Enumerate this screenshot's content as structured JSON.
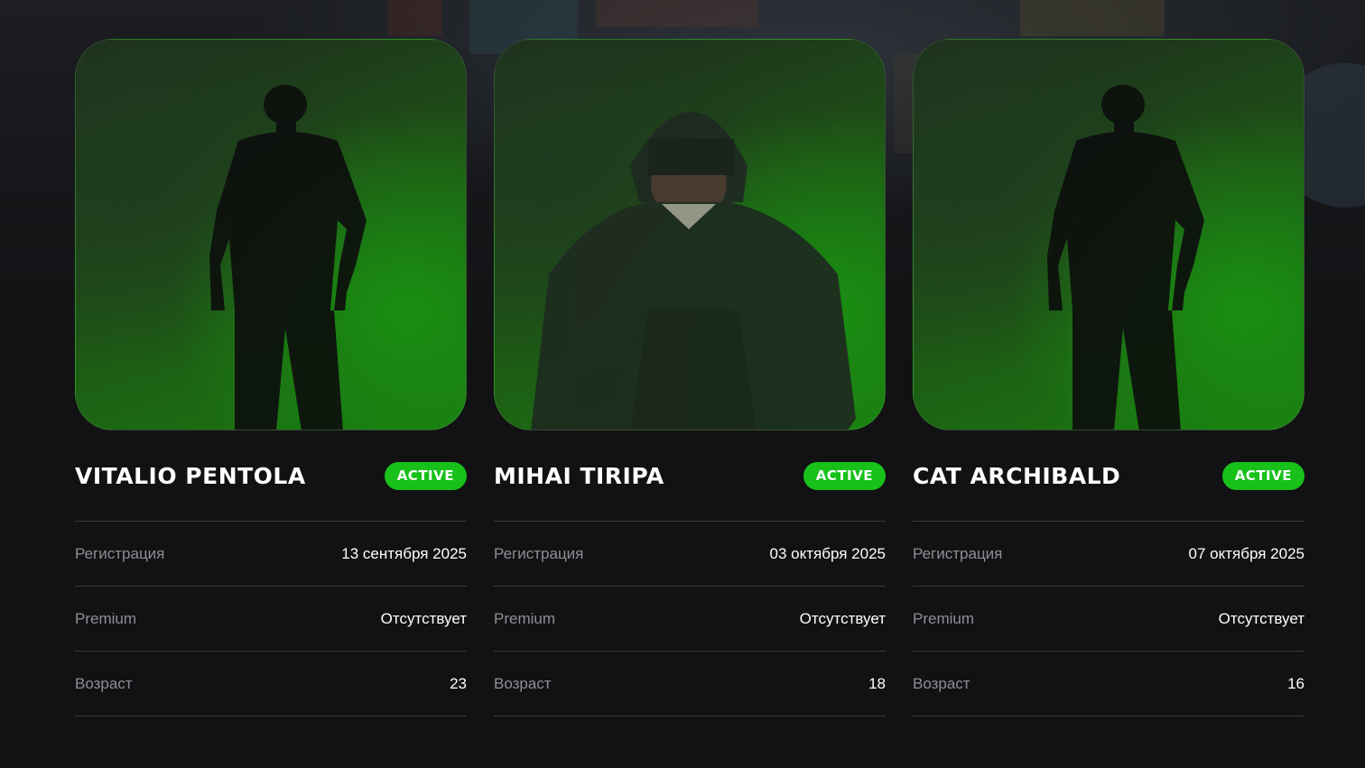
{
  "colors": {
    "background": "#121214",
    "badge": "#17c11a",
    "portrait_green": "#1a8f12",
    "divider": "#3a3b3f",
    "label": "#8e8f94"
  },
  "characters": [
    {
      "name": "VITALIO PENTOLA",
      "status": "ACTIVE",
      "portrait": "silhouette",
      "rows": [
        {
          "label": "Регистрация",
          "value": "13 сентября 2025"
        },
        {
          "label": "Premium",
          "value": "Отсутствует"
        },
        {
          "label": "Возраст",
          "value": "23"
        }
      ]
    },
    {
      "name": "MIHAI TIRIPA",
      "status": "ACTIVE",
      "portrait": "hooded-figure",
      "rows": [
        {
          "label": "Регистрация",
          "value": "03 октября 2025"
        },
        {
          "label": "Premium",
          "value": "Отсутствует"
        },
        {
          "label": "Возраст",
          "value": "18"
        }
      ]
    },
    {
      "name": "CAT ARCHIBALD",
      "status": "ACTIVE",
      "portrait": "silhouette",
      "rows": [
        {
          "label": "Регистрация",
          "value": "07 октября 2025"
        },
        {
          "label": "Premium",
          "value": "Отсутствует"
        },
        {
          "label": "Возраст",
          "value": "16"
        }
      ]
    }
  ]
}
